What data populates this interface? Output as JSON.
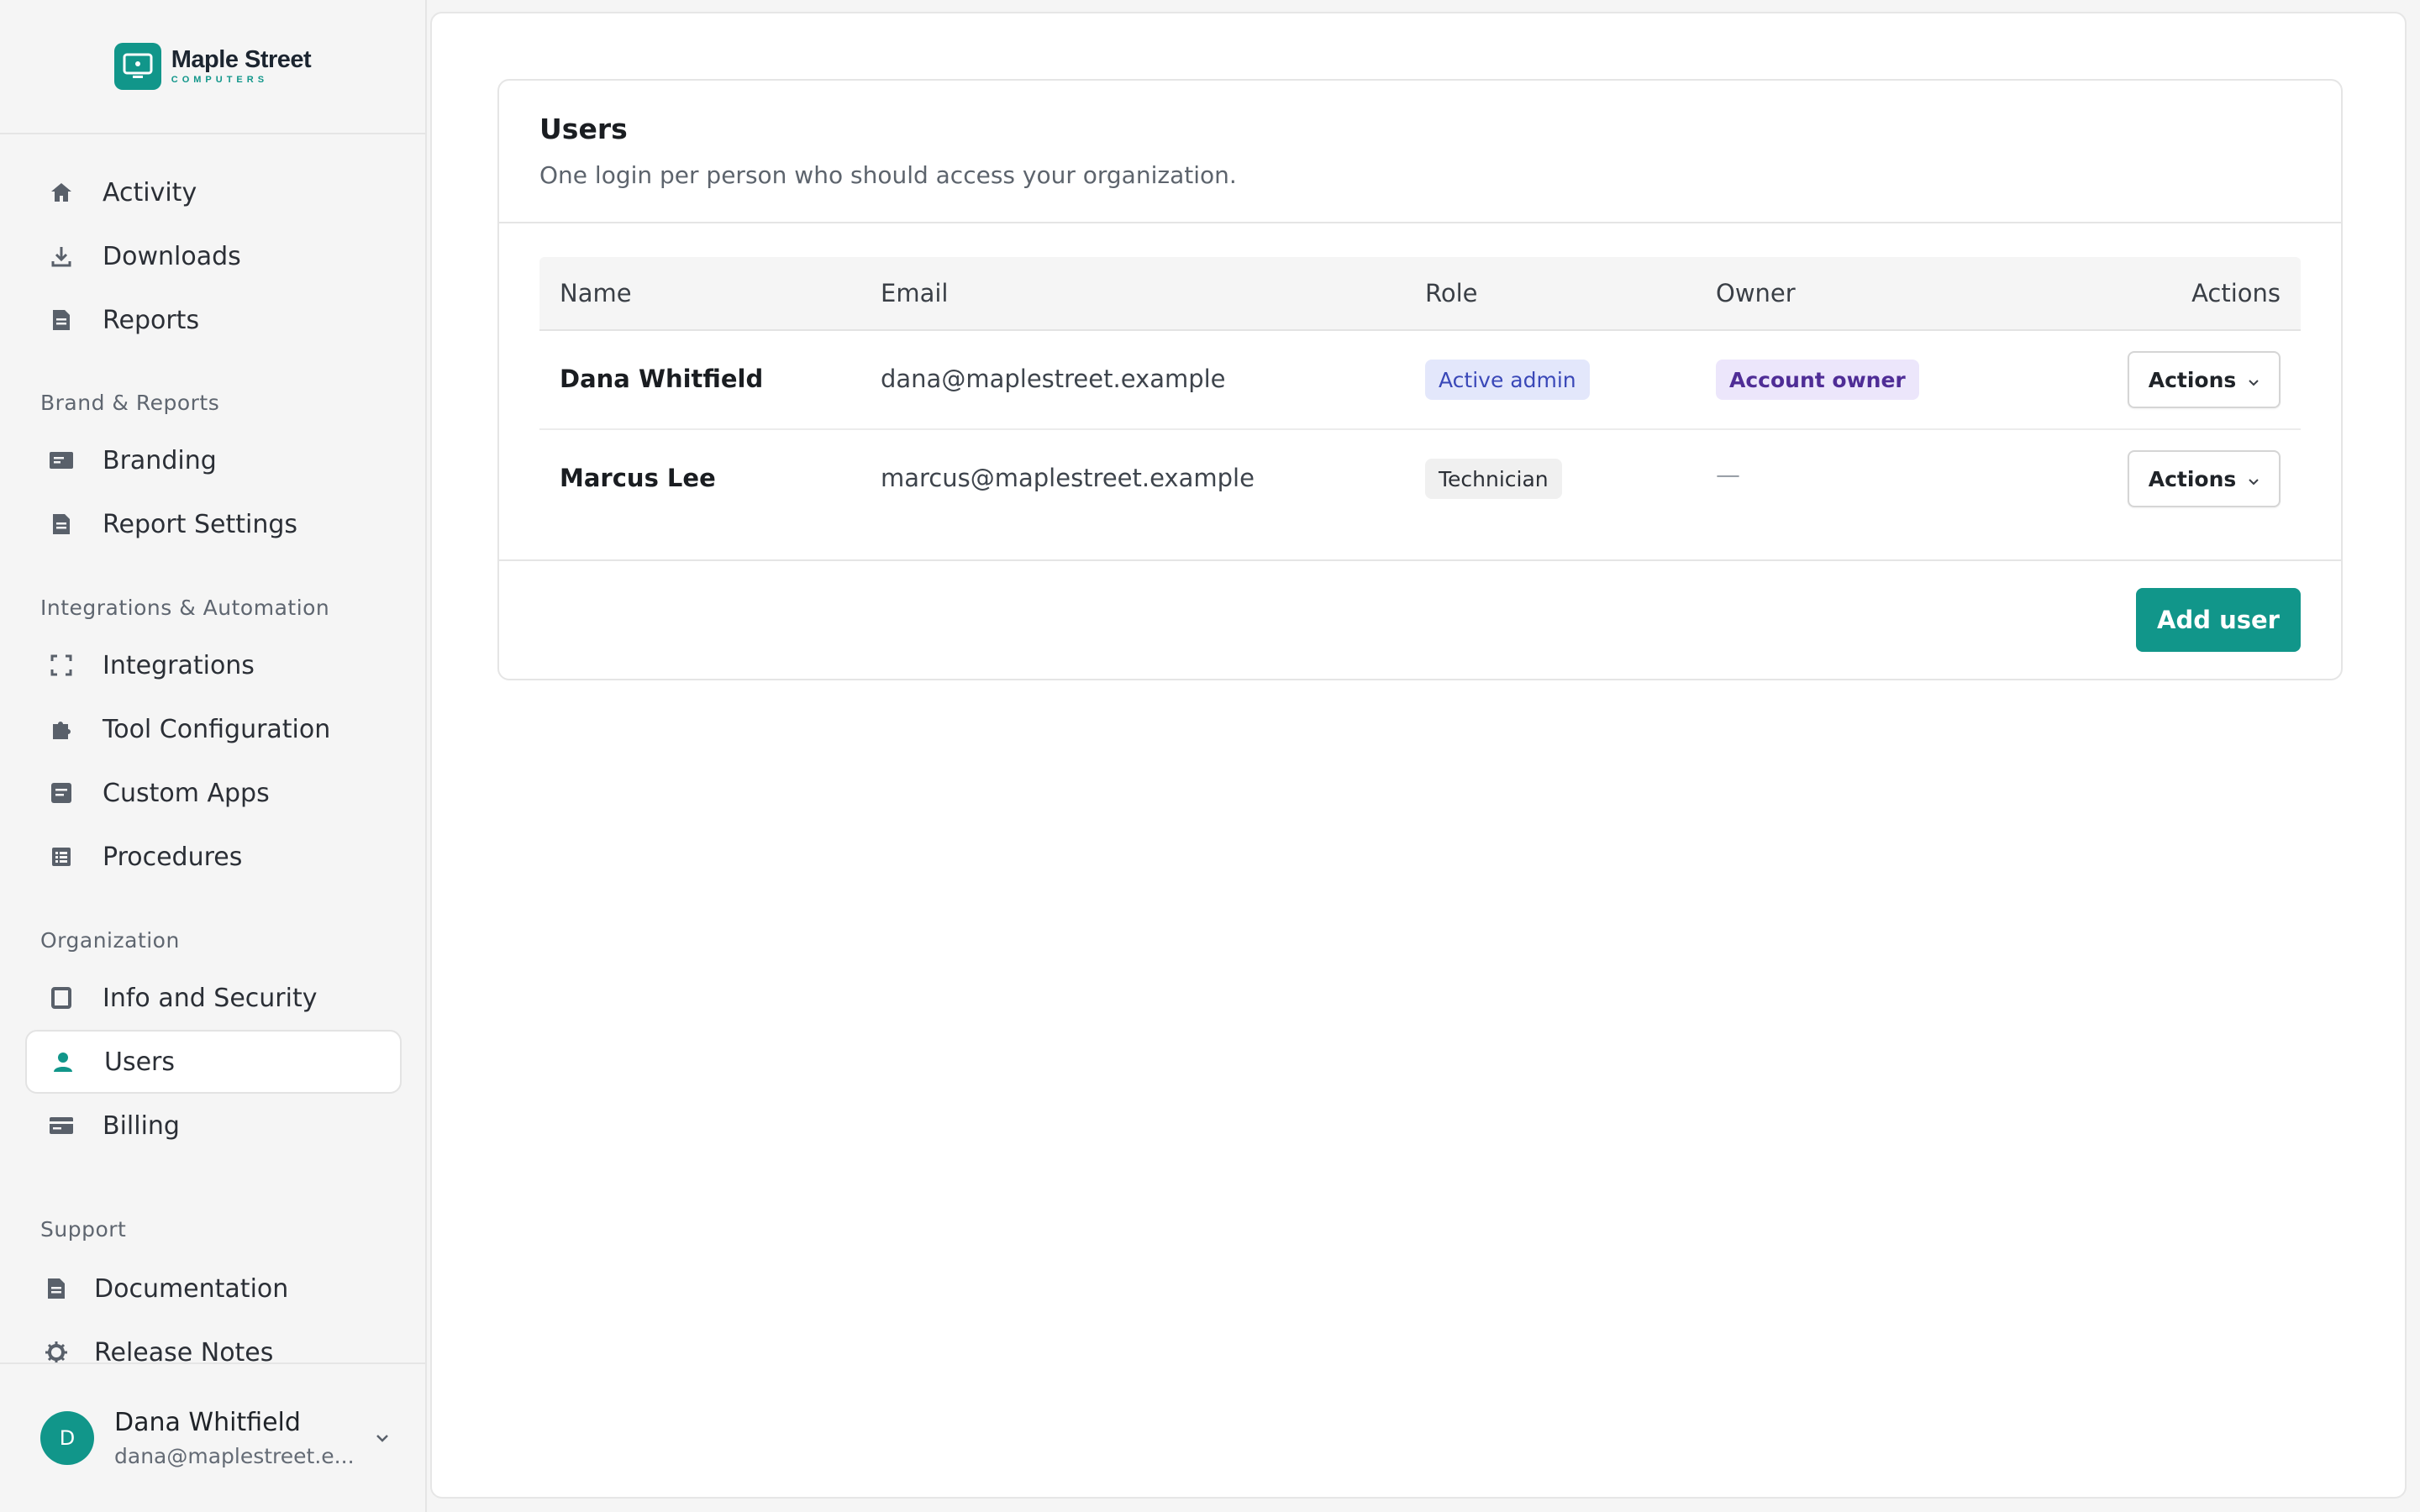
{
  "brand": {
    "name": "Maple Street",
    "tagline": "COMPUTERS",
    "logo_icon": "monitor-icon",
    "brand_color": "#11968a"
  },
  "sidebar": {
    "items": [
      {
        "label": "Activity",
        "icon": "home-icon"
      },
      {
        "label": "Downloads",
        "icon": "download-icon"
      },
      {
        "label": "Reports",
        "icon": "document-icon"
      },
      {
        "label": "Branding",
        "icon": "card-icon"
      },
      {
        "label": "Report Settings",
        "icon": "document-icon"
      },
      {
        "label": "Integrations",
        "icon": "integrations-icon"
      },
      {
        "label": "Tool Configuration",
        "icon": "puzzle-icon"
      },
      {
        "label": "Custom Apps",
        "icon": "app-icon"
      },
      {
        "label": "Procedures",
        "icon": "list-icon"
      },
      {
        "label": "Info and Security",
        "icon": "square-icon"
      },
      {
        "label": "Users",
        "icon": "user-icon",
        "active": true
      },
      {
        "label": "Billing",
        "icon": "credit-card-icon"
      },
      {
        "label": "Documentation",
        "icon": "document-icon"
      },
      {
        "label": "Release Notes",
        "icon": "gear-icon"
      }
    ],
    "sections": {
      "brand_reports": "Brand & Reports",
      "integrations": "Integrations & Automation",
      "organization": "Organization",
      "support": "Support"
    }
  },
  "current_user": {
    "initial": "D",
    "name": "Dana Whitfield",
    "email": "dana@maplestreet.e..."
  },
  "main": {
    "title": "Users",
    "subtitle": "One login per person who should access your organization.",
    "table": {
      "columns": [
        "Name",
        "Email",
        "Role",
        "Owner",
        "Actions"
      ],
      "rows": [
        {
          "name": "Dana Whitfield",
          "email": "dana@maplestreet.example",
          "role": "Active admin",
          "owner": "Account owner",
          "actions": "Actions"
        },
        {
          "name": "Marcus Lee",
          "email": "marcus@maplestreet.example",
          "role": "Technician",
          "owner": "—",
          "actions": "Actions"
        }
      ]
    },
    "add_user_label": "Add user"
  }
}
